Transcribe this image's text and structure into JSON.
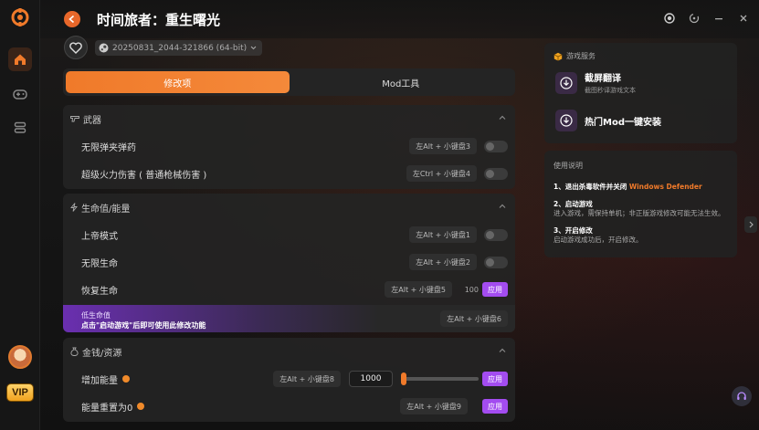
{
  "app": {
    "title": "时间旅者：重生曙光",
    "version_label": "20250831_2044-321866 (64-bit)",
    "accent": "#f07a2a",
    "purple": "#a34cf0"
  },
  "tabs": [
    {
      "label": "修改项",
      "active": true
    },
    {
      "label": "Mod工具",
      "active": false
    }
  ],
  "sections": {
    "weapons": {
      "title": "武器",
      "rows": [
        {
          "label": "无限弹夹弹药",
          "hotkey": "左Alt + 小键盘3"
        },
        {
          "label": "超级火力伤害 ( 普通枪械伤害 )",
          "hotkey": "左Ctrl + 小键盘4"
        }
      ]
    },
    "health": {
      "title": "生命值/能量",
      "rows": [
        {
          "label": "上帝模式",
          "hotkey": "左Alt + 小键盘1"
        },
        {
          "label": "无限生命",
          "hotkey": "左Alt + 小键盘2"
        },
        {
          "label": "恢复生命",
          "hotkey": "左Alt + 小键盘5",
          "value": "100",
          "apply": "应用"
        }
      ],
      "low_health": {
        "label": "低生命值",
        "notice": "点击\"启动游戏\"后即可使用此修改功能",
        "hotkey": "左Alt + 小键盘6"
      }
    },
    "money": {
      "title": "金钱/资源",
      "rows": [
        {
          "label": "增加能量",
          "hotkey": "左Alt + 小键盘8",
          "value": "1000",
          "apply": "应用"
        },
        {
          "label": "能量重置为0",
          "hotkey": "左Alt + 小键盘9",
          "apply": "应用"
        }
      ]
    }
  },
  "services": {
    "title": "游戏服务",
    "items": [
      {
        "title": "截屏翻译",
        "subtitle": "截图秒译游戏文本"
      },
      {
        "title": "热门Mod一键安装",
        "subtitle": ""
      }
    ]
  },
  "usage": {
    "title": "使用说明",
    "steps": [
      {
        "head": "1、退出杀毒软件并关闭 ",
        "highlight": "Windows Defender",
        "body": ""
      },
      {
        "head": "2、启动游戏",
        "body": "进入游戏，需保持单机；非正版游戏修改可能无法生效。"
      },
      {
        "head": "3、开启修改",
        "body": "启动游戏成功后，开启修改。"
      }
    ]
  },
  "sidebar": {
    "vip_label": "VIP"
  }
}
